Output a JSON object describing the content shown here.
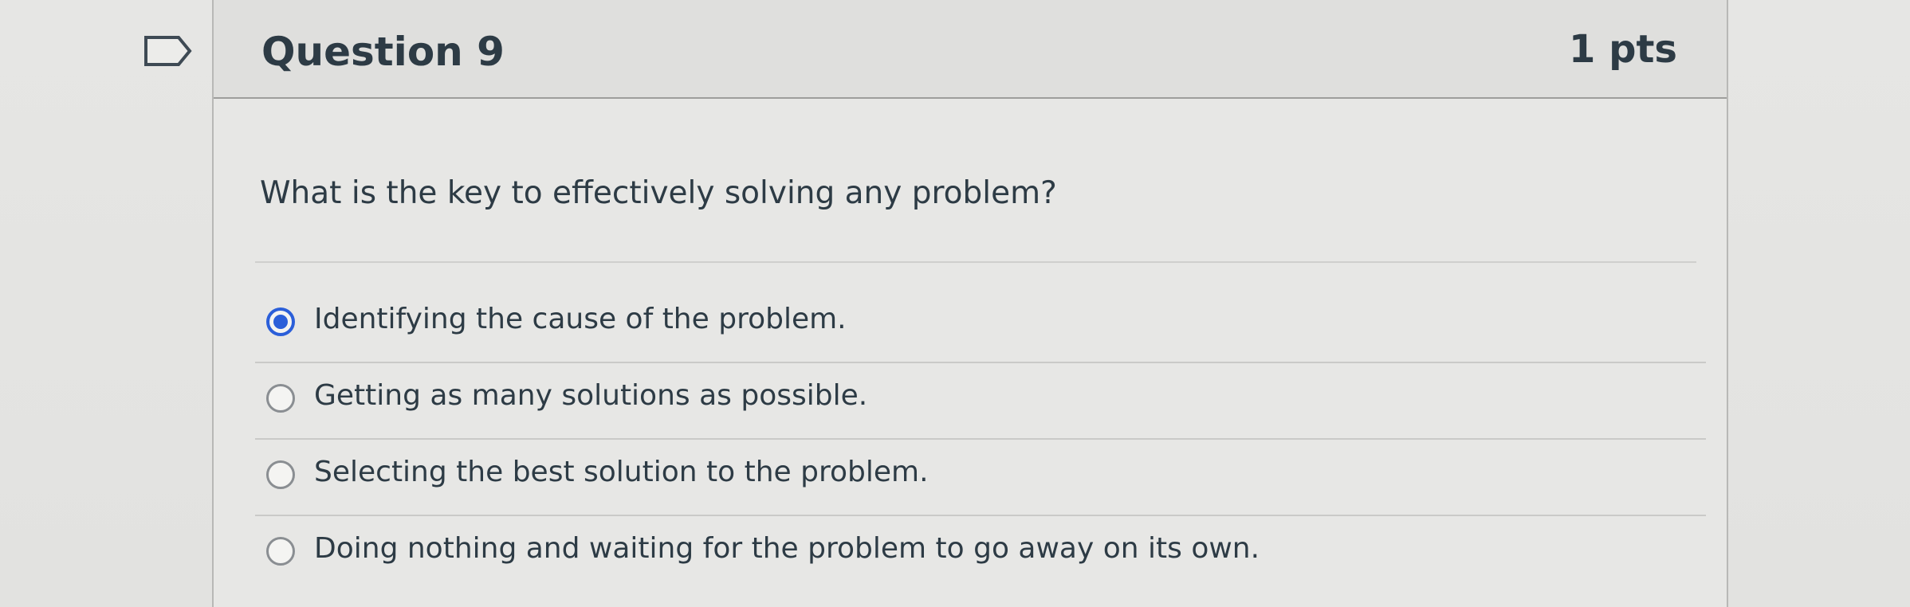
{
  "question": {
    "title": "Question 9",
    "points": "1 pts",
    "text": "What is the key to effectively solving any problem?",
    "flag_icon": "bookmark-flag-icon"
  },
  "answers": [
    {
      "label": "Identifying the cause of the problem.",
      "selected": true
    },
    {
      "label": "Getting as many solutions as possible.",
      "selected": false
    },
    {
      "label": "Selecting the best solution to the problem.",
      "selected": false
    },
    {
      "label": "Doing nothing and waiting for the problem to go away on its own.",
      "selected": false
    }
  ],
  "colors": {
    "accent": "#2b5fd9",
    "text": "#2d3b45"
  }
}
